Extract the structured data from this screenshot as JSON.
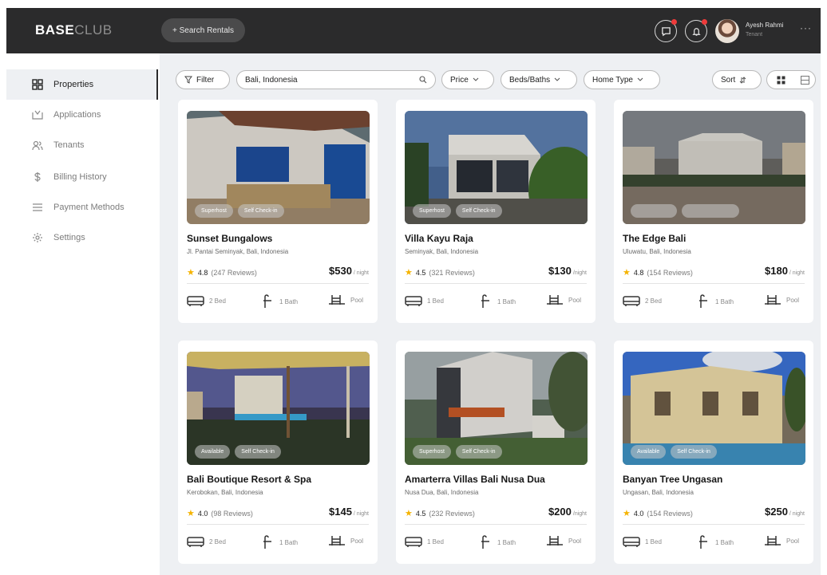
{
  "app": {
    "logo_bold": "BASE",
    "logo_light": "CLUB",
    "search_button": "+ Search Rentals",
    "user_name": "Ayesh Rahmi",
    "user_role": "Tenant"
  },
  "sidebar": {
    "items": [
      {
        "label": "Properties",
        "icon": "grid-icon",
        "active": true
      },
      {
        "label": "Applications",
        "icon": "applications-icon",
        "active": false
      },
      {
        "label": "Tenants",
        "icon": "tenants-icon",
        "active": false
      },
      {
        "label": "Billing History",
        "icon": "dollar-icon",
        "active": false
      },
      {
        "label": "Payment Methods",
        "icon": "payment-icon",
        "active": false
      },
      {
        "label": "Settings",
        "icon": "gear-icon",
        "active": false
      }
    ]
  },
  "filters": {
    "filter_label": "Filter",
    "search_value": "Bali, Indonesia",
    "price_label": "Price",
    "beds_label": "Beds/Baths",
    "home_type_label": "Home Type",
    "sort_label": "Sort"
  },
  "colors": {
    "topbar": "#2b2b2c",
    "background": "#eef0f3",
    "star": "#f5b300",
    "notification": "#ef3b3b"
  },
  "properties": [
    {
      "title": "Sunset Bungalows",
      "location": "Jl. Pantai Seminyak, Bali, Indonesia",
      "rating": "4.8",
      "reviews": "(247 Reviews)",
      "price": "$530",
      "period": "/ night",
      "tags": [
        "Superhost",
        "Self Check-in"
      ],
      "beds": "2 Bed",
      "baths": "1 Bath",
      "pool": "Pool"
    },
    {
      "title": "Villa Kayu Raja",
      "location": "Seminyak, Bali, Indonesia",
      "rating": "4.5",
      "reviews": "(321 Reviews)",
      "price": "$130",
      "period": "/night",
      "tags": [
        "Superhost",
        "Self Check-in"
      ],
      "beds": "1 Bed",
      "baths": "1 Bath",
      "pool": "Pool"
    },
    {
      "title": "The Edge Bali",
      "location": "Uluwatu, Bali, Indonesia",
      "rating": "4.8",
      "reviews": "(154 Reviews)",
      "price": "$180",
      "period": "/ night",
      "tags": [
        "",
        ""
      ],
      "beds": "2 Bed",
      "baths": "1 Bath",
      "pool": "Pool"
    },
    {
      "title": "Bali Boutique Resort & Spa",
      "location": "Kerobokan, Bali, Indonesia",
      "rating": "4.0",
      "reviews": "(98 Reviews)",
      "price": "$145",
      "period": "/ night",
      "tags": [
        "Available",
        "Self Check-in"
      ],
      "beds": "2 Bed",
      "baths": "1 Bath",
      "pool": "Pool"
    },
    {
      "title": "Amarterra Villas Bali Nusa Dua",
      "location": "Nusa Dua, Bali, Indonesia",
      "rating": "4.5",
      "reviews": "(232 Reviews)",
      "price": "$200",
      "period": "/night",
      "tags": [
        "Superhost",
        "Self Check-in"
      ],
      "beds": "1 Bed",
      "baths": "1 Bath",
      "pool": "Pool"
    },
    {
      "title": "Banyan Tree Ungasan",
      "location": "Ungasan, Bali, Indonesia",
      "rating": "4.0",
      "reviews": "(154 Reviews)",
      "price": "$250",
      "period": "/ night",
      "tags": [
        "Available",
        "Self Check-in"
      ],
      "beds": "1 Bed",
      "baths": "1 Bath",
      "pool": "Pool"
    }
  ]
}
